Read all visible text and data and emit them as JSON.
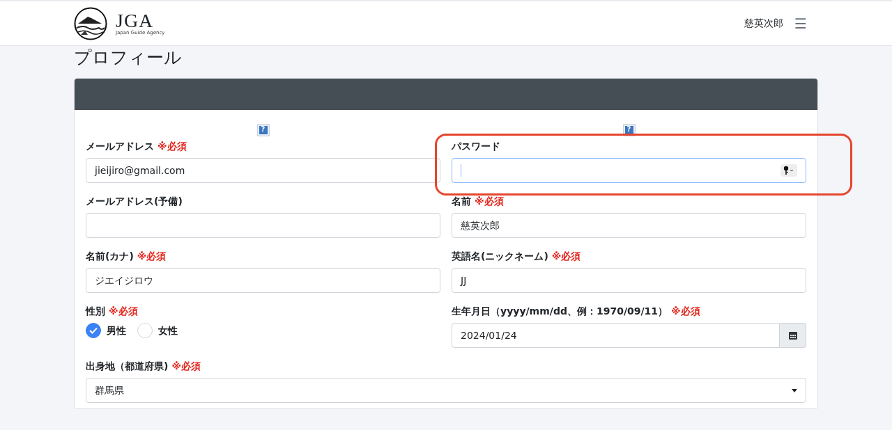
{
  "header": {
    "logo_title": "JGA",
    "logo_subtitle": "Japan Guide Agency",
    "user_name": "慈英次郎",
    "menu_glyph": "☰"
  },
  "page_title": "プロフィール",
  "help_marks": [
    "?",
    "?"
  ],
  "fields": [
    {
      "kind": "text",
      "label": "メールアドレス",
      "required_mark": "※必須",
      "value": "jieijiro@gmail.com",
      "focused": false
    },
    {
      "kind": "password",
      "label": "パスワード",
      "focused": true,
      "highlighted": true
    },
    {
      "kind": "text",
      "label": "メールアドレス(予備)",
      "focused": false
    },
    {
      "kind": "text",
      "label": "名前",
      "required_mark": "※必須",
      "value": "慈英次郎",
      "focused": false
    },
    {
      "kind": "text",
      "label": "名前(カナ)",
      "required_mark": "※必須",
      "value": "ジエイジロウ",
      "focused": false
    },
    {
      "kind": "text",
      "label": "英語名(ニックネーム)",
      "required_mark": "※必須",
      "value": "JJ",
      "focused": false
    },
    {
      "kind": "radio",
      "label": "性別",
      "required_mark": "※必須",
      "options": [
        {
          "label": "男性",
          "selected": true
        },
        {
          "label": "女性",
          "selected": false
        }
      ]
    },
    {
      "kind": "date",
      "label": "生年月日（yyyy/mm/dd、例：1970/09/11）",
      "required_mark": "※必須",
      "value": "2024/01/24",
      "focused": false
    },
    {
      "kind": "select",
      "label": "出身地（都道府県)",
      "required_mark": "※必須",
      "value": "群馬県",
      "focused": false,
      "wide": true
    }
  ]
}
